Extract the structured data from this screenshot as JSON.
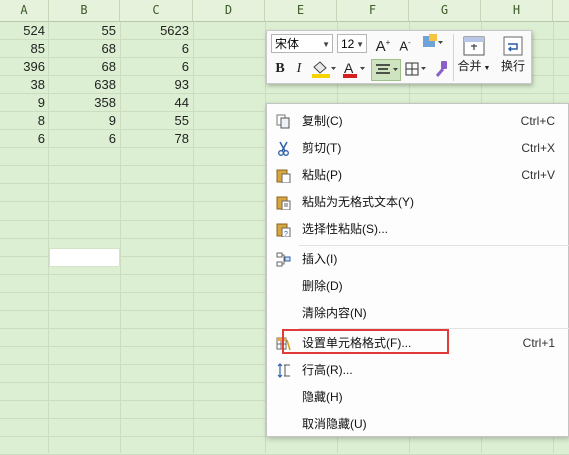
{
  "columns": [
    "A",
    "B",
    "C",
    "D",
    "E",
    "F",
    "G",
    "H"
  ],
  "rows": [
    [
      "524",
      "55",
      "5623"
    ],
    [
      "85",
      "68",
      "6"
    ],
    [
      "396",
      "68",
      "6"
    ],
    [
      "38",
      "638",
      "93"
    ],
    [
      "9",
      "358",
      "44"
    ],
    [
      "8",
      "9",
      "55"
    ],
    [
      "6",
      "6",
      "78"
    ]
  ],
  "mini_toolbar": {
    "font_name": "宋体",
    "font_size": "12",
    "bold": "B",
    "italic": "I",
    "font_color_letter": "A",
    "grow_font": "A",
    "shrink_font": "A",
    "merge_label": "合并",
    "wrap_label": "换行",
    "accent_red": "#d42020",
    "highlight_yellow": "#f5d400"
  },
  "context_menu": {
    "items": [
      {
        "label": "复制(C)",
        "shortcut": "Ctrl+C",
        "icon": "copy-icon"
      },
      {
        "label": "剪切(T)",
        "shortcut": "Ctrl+X",
        "icon": "scissors-icon"
      },
      {
        "label": "粘贴(P)",
        "shortcut": "Ctrl+V",
        "icon": "paste-icon"
      },
      {
        "label": "粘贴为无格式文本(Y)",
        "shortcut": "",
        "icon": "paste-text-icon"
      },
      {
        "label": "选择性粘贴(S)...",
        "shortcut": "",
        "icon": "paste-special-icon"
      },
      {
        "label": "插入(I)",
        "shortcut": "",
        "icon": "insert-icon"
      },
      {
        "label": "删除(D)",
        "shortcut": "",
        "icon": ""
      },
      {
        "label": "清除内容(N)",
        "shortcut": "",
        "icon": ""
      },
      {
        "label": "设置单元格格式(F)...",
        "shortcut": "Ctrl+1",
        "icon": "format-cells-icon"
      },
      {
        "label": "行高(R)...",
        "shortcut": "",
        "icon": "row-height-icon"
      },
      {
        "label": "隐藏(H)",
        "shortcut": "",
        "icon": ""
      },
      {
        "label": "取消隐藏(U)",
        "shortcut": "",
        "icon": ""
      }
    ]
  }
}
